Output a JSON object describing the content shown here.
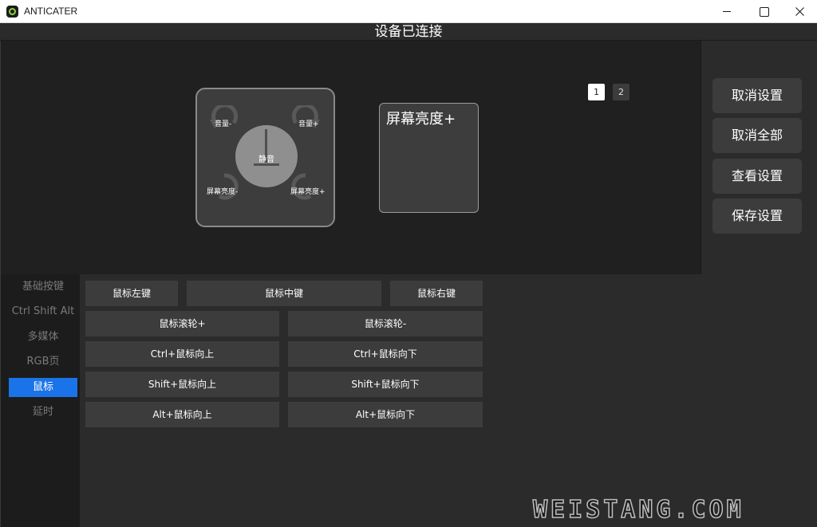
{
  "window": {
    "title": "ANTICATER"
  },
  "status": {
    "text": "设备已连接"
  },
  "pages": [
    "1",
    "2"
  ],
  "knob": {
    "center_label": "静音",
    "volume_down": "音量-",
    "volume_up": "音量+",
    "brightness_down": "屏幕亮度-",
    "brightness_up": "屏幕亮度+"
  },
  "key_preview": {
    "label": "屏幕亮度+"
  },
  "actions": {
    "cancel_setting": "取消设置",
    "cancel_all": "取消全部",
    "view_setting": "查看设置",
    "save_setting": "保存设置"
  },
  "nav": {
    "items": [
      "基础按键",
      "Ctrl Shift Alt",
      "多媒体",
      "RGB页",
      "鼠标",
      "延时"
    ],
    "active": "鼠标"
  },
  "mouse_keys": {
    "left": "鼠标左键",
    "middle": "鼠标中键",
    "right": "鼠标右键",
    "wheel_up": "鼠标滚轮+",
    "wheel_down": "鼠标滚轮-",
    "ctrl_up": "Ctrl+鼠标向上",
    "ctrl_down": "Ctrl+鼠标向下",
    "shift_up": "Shift+鼠标向上",
    "shift_down": "Shift+鼠标向下",
    "alt_up": "Alt+鼠标向上",
    "alt_down": "Alt+鼠标向下"
  },
  "watermark": {
    "text": "WEISTANG.COM"
  },
  "colors": {
    "accent": "#1a73e8",
    "background": "#202020",
    "panel": "#2b2b2b",
    "button": "#3c3c3c"
  }
}
